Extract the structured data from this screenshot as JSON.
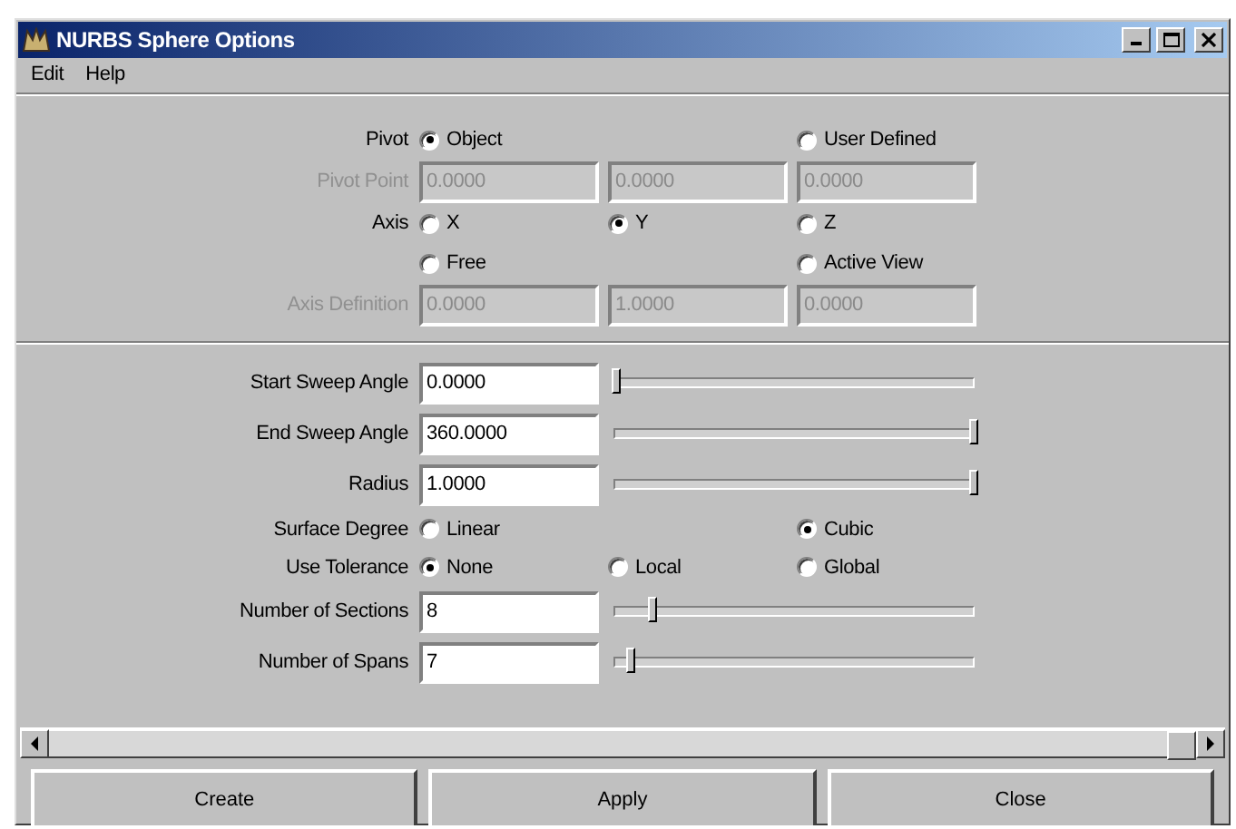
{
  "window": {
    "title": "NURBS Sphere Options"
  },
  "menu": [
    {
      "label": "Edit"
    },
    {
      "label": "Help"
    }
  ],
  "sections": [
    {
      "rows": [
        {
          "kind": "radio",
          "label": "Pivot",
          "options": [
            {
              "kind": "radio",
              "label": "Object",
              "selected": true
            },
            {
              "kind": "gap"
            },
            {
              "kind": "radio",
              "label": "User Defined",
              "selected": false
            }
          ]
        },
        {
          "kind": "fields",
          "label": "Pivot Point",
          "disabled": true,
          "values": [
            "0.0000",
            "0.0000",
            "0.0000"
          ]
        },
        {
          "kind": "radio",
          "label": "Axis",
          "options": [
            {
              "kind": "radio",
              "label": "X",
              "selected": false
            },
            {
              "kind": "radio",
              "label": "Y",
              "selected": true
            },
            {
              "kind": "radio",
              "label": "Z",
              "selected": false
            }
          ]
        },
        {
          "kind": "radio",
          "options": [
            {
              "kind": "radio",
              "label": "Free",
              "selected": false
            },
            {
              "kind": "gap"
            },
            {
              "kind": "radio",
              "label": "Active View",
              "selected": false
            }
          ]
        },
        {
          "kind": "fields",
          "label": "Axis Definition",
          "disabled": true,
          "values": [
            "0.0000",
            "1.0000",
            "0.0000"
          ]
        }
      ]
    },
    {
      "rows": [
        {
          "kind": "slider",
          "label": "Start Sweep Angle",
          "value": "0.0000",
          "level": 0
        },
        {
          "kind": "slider",
          "label": "End Sweep Angle",
          "value": "360.0000",
          "level": 1
        },
        {
          "kind": "slider",
          "label": "Radius",
          "value": "1.0000",
          "level": 1
        },
        {
          "kind": "radio",
          "label": "Surface Degree",
          "options": [
            {
              "kind": "radio",
              "label": "Linear",
              "selected": false
            },
            {
              "kind": "gap"
            },
            {
              "kind": "radio",
              "label": "Cubic",
              "selected": true
            }
          ]
        },
        {
          "kind": "radio",
          "label": "Use Tolerance",
          "options": [
            {
              "kind": "radio",
              "label": "None",
              "selected": true
            },
            {
              "kind": "radio",
              "label": "Local",
              "selected": false
            },
            {
              "kind": "radio",
              "label": "Global",
              "selected": false
            }
          ]
        },
        {
          "kind": "slider",
          "label": "Number of Sections",
          "value": "8",
          "level": 0.1
        },
        {
          "kind": "slider",
          "label": "Number of Spans",
          "value": "7",
          "level": 0.04
        }
      ]
    }
  ],
  "buttons": [
    {
      "label": "Create"
    },
    {
      "label": "Apply"
    },
    {
      "label": "Close"
    }
  ]
}
